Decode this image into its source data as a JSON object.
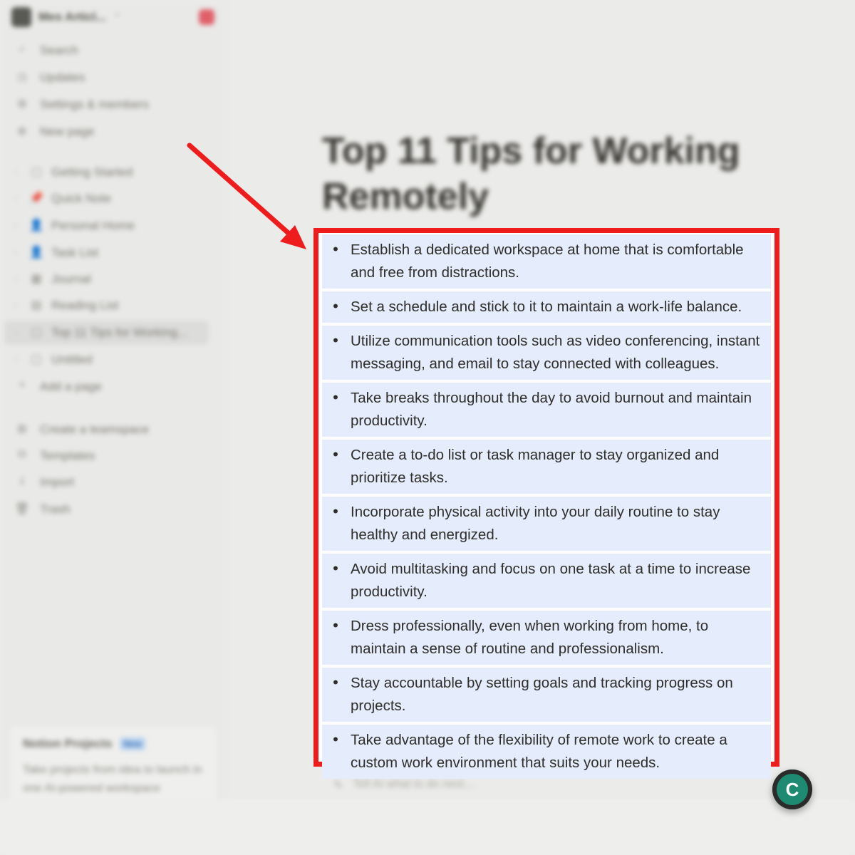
{
  "sidebar": {
    "workspace_name": "Mes Articl...",
    "workspace_chevron": "⌃",
    "top_items": [
      {
        "icon": "search-icon",
        "label": "Search"
      },
      {
        "icon": "clock-icon",
        "label": "Updates"
      },
      {
        "icon": "gear-icon",
        "label": "Settings & members"
      },
      {
        "icon": "plus-circle-icon",
        "label": "New page"
      }
    ],
    "pages": [
      {
        "icon": "page-icon",
        "label": "Getting Started"
      },
      {
        "icon": "pin-icon",
        "label": "Quick Note"
      },
      {
        "icon": "person-icon",
        "label": "Personal Home"
      },
      {
        "icon": "person-icon",
        "label": "Task List"
      },
      {
        "icon": "calendar-icon",
        "label": "Journal"
      },
      {
        "icon": "book-icon",
        "label": "Reading List"
      },
      {
        "icon": "page-icon",
        "label": "Top 11 Tips for Working..."
      },
      {
        "icon": "page-icon",
        "label": "Untitled"
      }
    ],
    "add_page": "Add a page",
    "bottom_items": [
      {
        "icon": "team-icon",
        "label": "Create a teamspace"
      },
      {
        "icon": "templates-icon",
        "label": "Templates"
      },
      {
        "icon": "import-icon",
        "label": "Import"
      },
      {
        "icon": "trash-icon",
        "label": "Trash"
      }
    ],
    "promo": {
      "title": "Notion Projects",
      "badge": "New",
      "text": "Take projects from idea to launch in one AI-powered workspace"
    }
  },
  "main": {
    "page_title": "Top 11 Tips for Working Remotely",
    "tips": [
      "Establish a dedicated workspace at home that is comfortable and free from distractions.",
      "Set a schedule and stick to it to maintain a work-life balance.",
      "Utilize communication tools such as video conferencing, instant messaging, and email to stay connected with colleagues.",
      "Take breaks throughout the day to avoid burnout and maintain productivity.",
      "Create a to-do list or task manager to stay organized and prioritize tasks.",
      "Incorporate physical activity into your daily routine to stay healthy and energized.",
      "Avoid multitasking and focus on one task at a time to increase productivity.",
      "Dress professionally, even when working from home, to maintain a sense of routine and professionalism.",
      "Stay accountable by setting goals and tracking progress on projects.",
      "Take advantage of the flexibility of remote work to create a custom work environment that suits your needs."
    ],
    "ai_hint": "Tell AI what to do next...",
    "help_glyph": "C"
  },
  "colors": {
    "highlight": "#ee1c1c",
    "selection": "#e5ecfb",
    "help_button": "#1f8a72"
  }
}
